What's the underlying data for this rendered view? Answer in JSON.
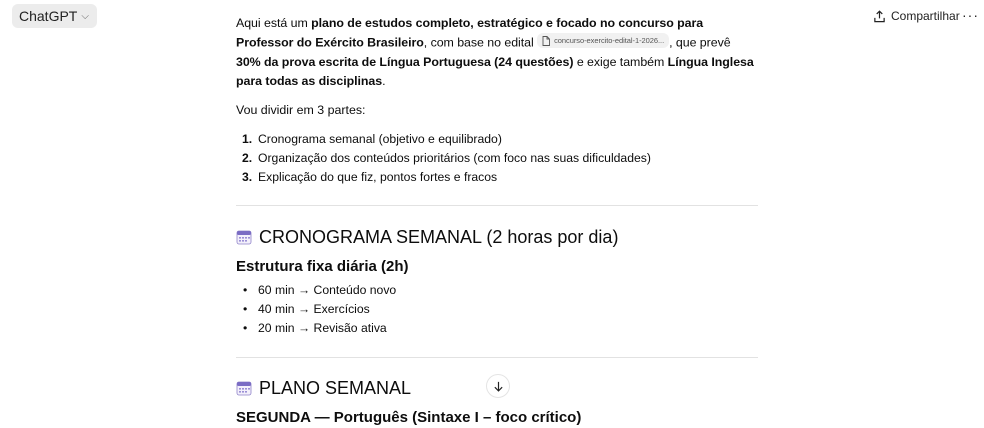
{
  "header": {
    "model_label": "ChatGPT",
    "share_label": "Compartilhar",
    "more_label": "···"
  },
  "intro": {
    "t1": "Aqui está um ",
    "b1": "plano de estudos completo, estratégico e focado no concurso para Professor do Exército Brasileiro",
    "t2": ", com base no edital ",
    "file": "concurso-exercito-edital-1-2026...",
    "t3": ", que prevê ",
    "b2": "30% da prova escrita de Língua Portuguesa (24 questões)",
    "t4": " e exige também ",
    "b3": "Língua Inglesa para todas as disciplinas",
    "t5": "."
  },
  "divide_text": "Vou dividir em 3 partes:",
  "parts": [
    {
      "num": "1.",
      "text": "Cronograma semanal (objetivo e equilibrado)"
    },
    {
      "num": "2.",
      "text": "Organização dos conteúdos prioritários (com foco nas suas dificuldades)"
    },
    {
      "num": "3.",
      "text": "Explicação do que fiz, pontos fortes e fracos"
    }
  ],
  "section1": {
    "title": "CRONOGRAMA SEMANAL (2 horas por dia)",
    "subtitle": "Estrutura fixa diária (2h)",
    "items": [
      "60 min → Conteúdo novo",
      "40 min → Exercícios",
      "20 min → Revisão ativa"
    ]
  },
  "section2": {
    "title": "PLANO SEMANAL",
    "subtitle": "SEGUNDA — Português (Sintaxe I – foco crítico)"
  },
  "icons": {
    "calendar": "calendar-icon",
    "share": "share-icon",
    "file": "file-icon",
    "scroll": "arrow-down-icon"
  }
}
